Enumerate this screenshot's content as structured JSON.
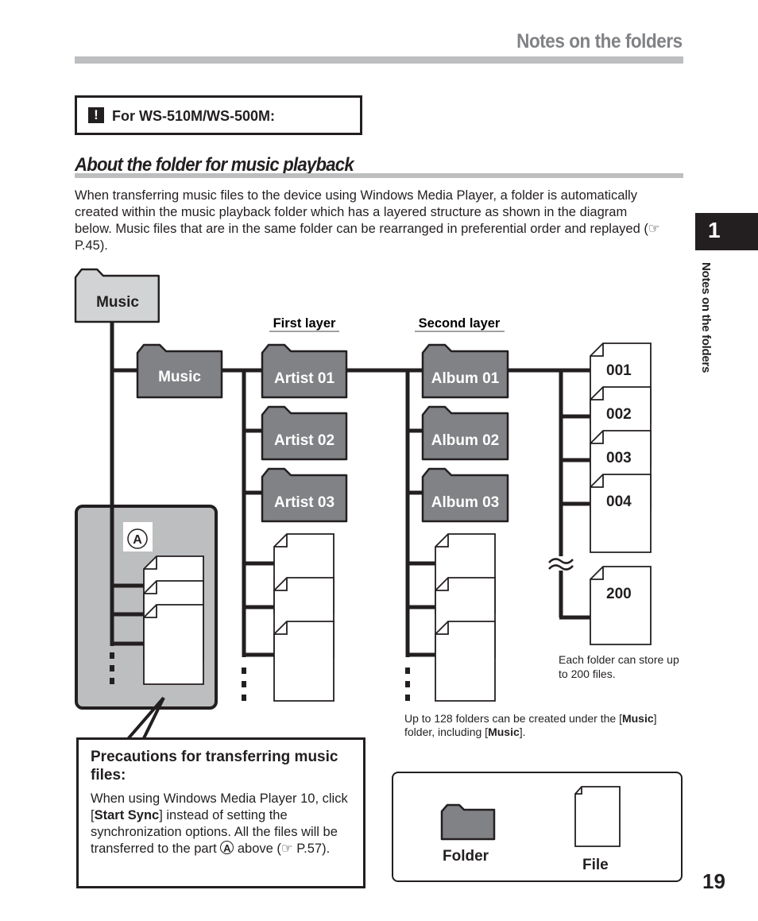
{
  "header": {
    "title": "Notes on the folders"
  },
  "model_note": {
    "icon": "exclamation-icon",
    "icon_glyph": "!",
    "text": "For WS-510M/WS-500M:"
  },
  "section": {
    "title": "About the folder for music playback",
    "intro": "When transferring music files to the device using Windows Media Player, a folder is automatically created within the music playback folder which has a layered structure as shown in the diagram below. Music files that are in the same folder can be rearranged in preferential order and replayed (☞ P.45)."
  },
  "chapter": {
    "number": "1",
    "side_label": "Notes on the folders"
  },
  "diagram": {
    "root_folder": "Music",
    "music_folder": "Music",
    "layer_labels": {
      "first": "First layer",
      "second": "Second layer"
    },
    "artists": [
      "Artist 01",
      "Artist 02",
      "Artist 03"
    ],
    "albums": [
      "Album 01",
      "Album 02",
      "Album 03"
    ],
    "files": [
      "001",
      "002",
      "003",
      "004",
      "200"
    ],
    "part_marker": "A",
    "note_files": "Each folder can store up to 200 files.",
    "note_folders_pre": "Up to 128 folders can be created under the [",
    "note_folders_b1": "Music",
    "note_folders_mid": "] folder, including [",
    "note_folders_b2": "Music",
    "note_folders_post": "]."
  },
  "precaution": {
    "title": "Precautions for transferring music files:",
    "body_1": "When using Windows Media Player 10, click [",
    "body_bold": "Start Sync",
    "body_2": "] instead of setting the synchronization options. All the files will be transferred to the part ",
    "body_marker": "A",
    "body_3": " above (☞ P.57)."
  },
  "legend": {
    "folder_label": "Folder",
    "file_label": "File"
  },
  "page_number": "19",
  "colors": {
    "folder_fill": "#808285",
    "root_folder_fill": "#d1d3d4",
    "rule_gray": "#bcbec0",
    "ink": "#231f20",
    "part_a_fill": "#bcbec0"
  }
}
